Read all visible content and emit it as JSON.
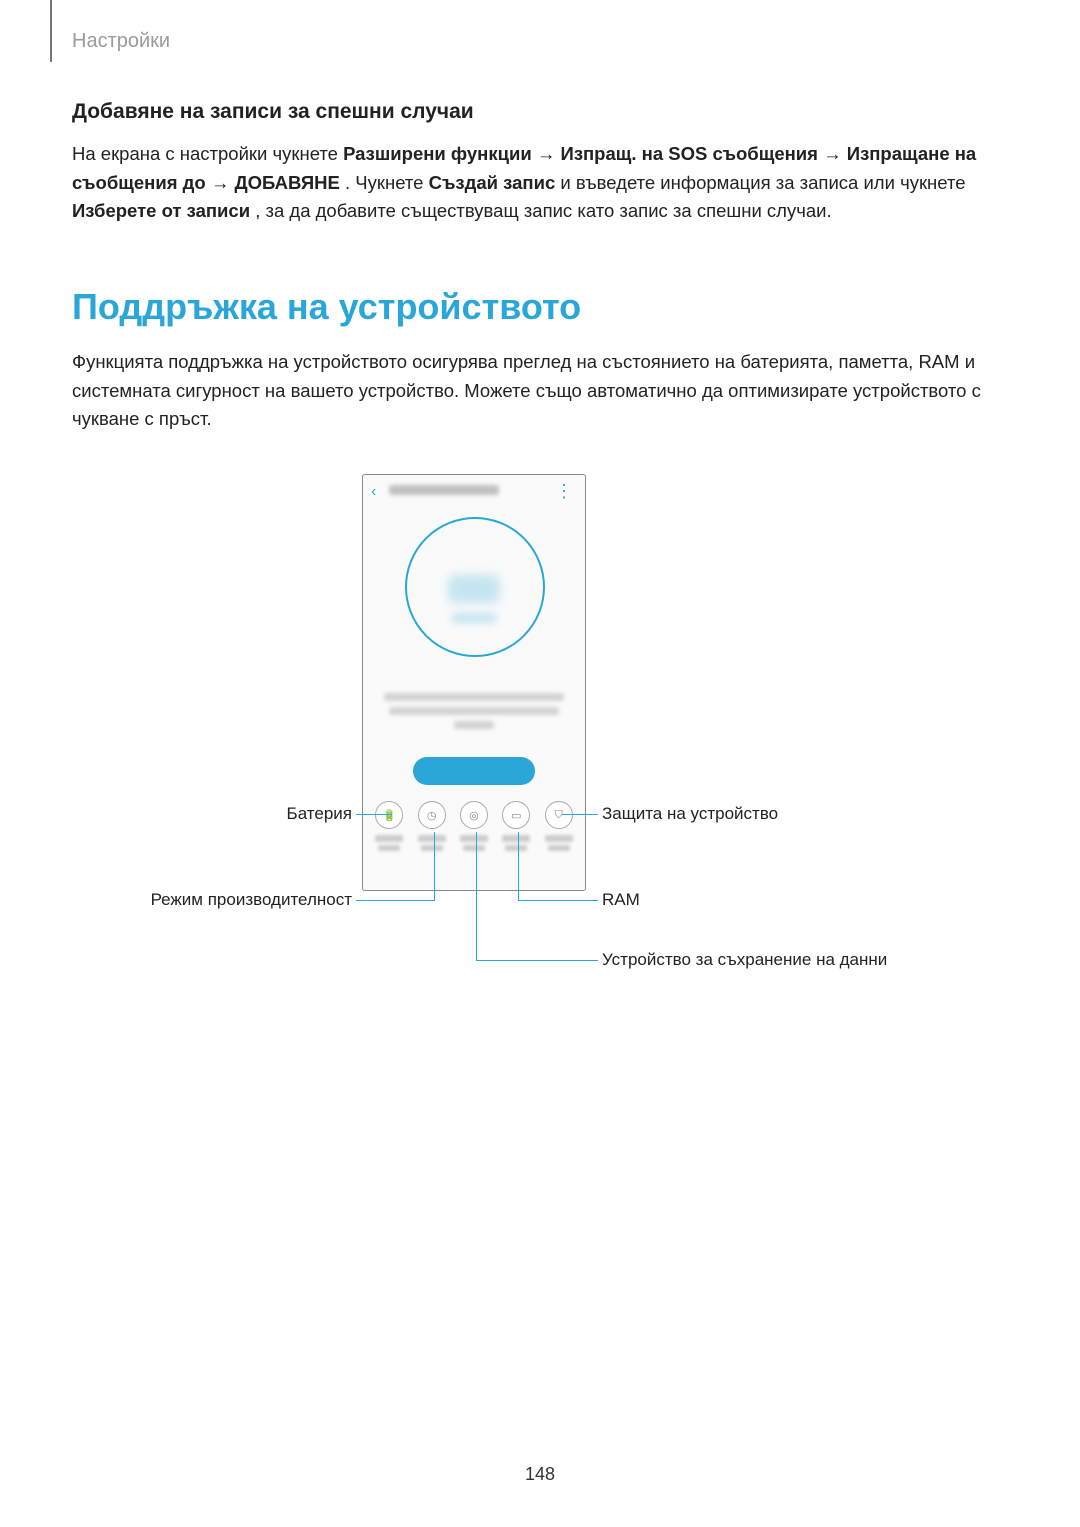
{
  "breadcrumb": "Настройки",
  "sub_heading": "Добавяне на записи за спешни случаи",
  "para1_parts": {
    "p1": "На екрана с настройки чукнете ",
    "b1": "Разширени функции",
    "arrow": " → ",
    "b2": "Изпращ. на SOS съобщения",
    "b3": "Изпращане на съобщения до",
    "b4": "ДОБАВЯНЕ",
    "p2": ". Чукнете ",
    "b5": "Създай запис",
    "p3": " и въведете информация за записа или чукнете ",
    "b6": "Изберете от записи",
    "p4": ", за да добавите съществуващ запис като запис за спешни случаи."
  },
  "main_heading": "Поддръжка на устройството",
  "para2": "Функцията поддръжка на устройството осигурява преглед на състоянието на батерията, паметта, RAM и системната сигурност на вашето устройство. Можете също автоматично да оптимизирате устройството с чукване с пръст.",
  "callouts": {
    "battery": "Батерия",
    "perf_mode": "Режим производителност",
    "security": "Защита на устройство",
    "ram": "RAM",
    "storage": "Устройство за съхранение на данни"
  },
  "page_number": "148"
}
